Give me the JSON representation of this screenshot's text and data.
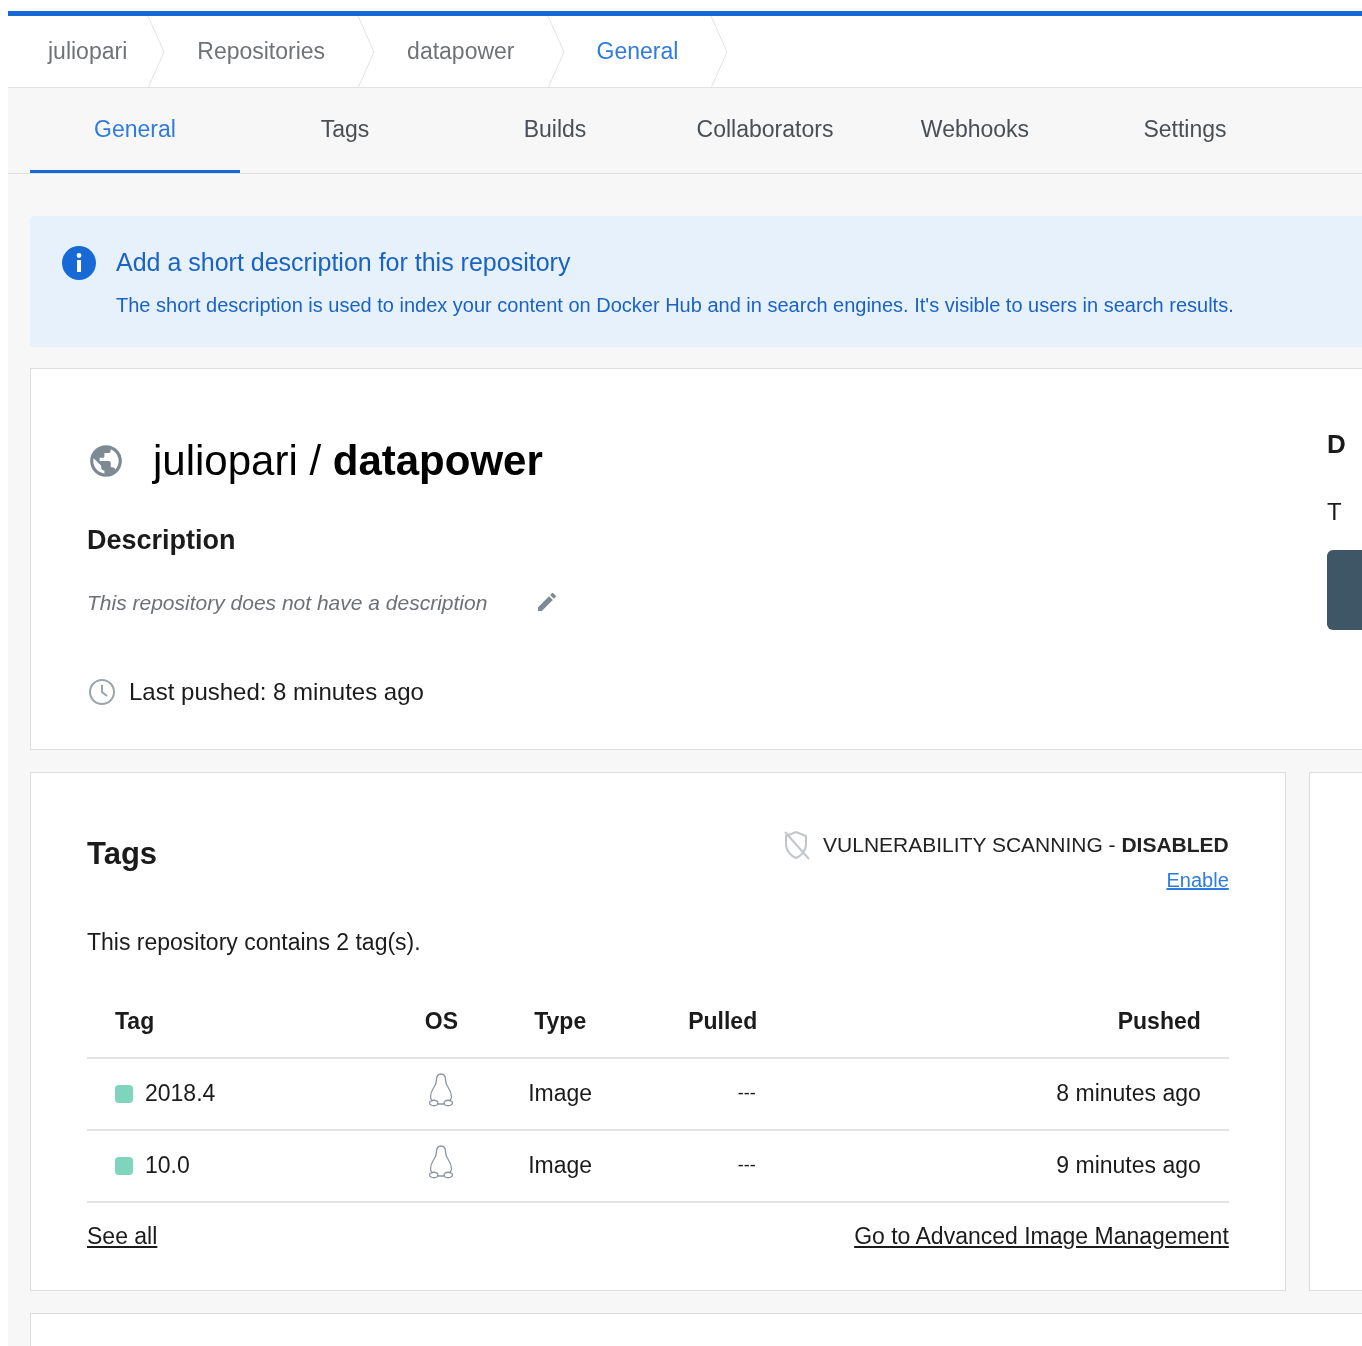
{
  "breadcrumbs": [
    {
      "label": "juliopari",
      "selected": false
    },
    {
      "label": "Repositories",
      "selected": false
    },
    {
      "label": "datapower",
      "selected": false
    },
    {
      "label": "General",
      "selected": true
    }
  ],
  "tabs": [
    {
      "label": "General",
      "selected": true
    },
    {
      "label": "Tags",
      "selected": false
    },
    {
      "label": "Builds",
      "selected": false
    },
    {
      "label": "Collaborators",
      "selected": false
    },
    {
      "label": "Webhooks",
      "selected": false
    },
    {
      "label": "Settings",
      "selected": false
    }
  ],
  "notice": {
    "title": "Add a short description for this repository",
    "text": "The short description is used to index your content on Docker Hub and in search engines. It's visible to users in search results."
  },
  "repository": {
    "owner": "juliopari",
    "separator": "/",
    "name": "datapower",
    "description_heading": "Description",
    "description": "This repository does not have a description",
    "last_pushed": "Last pushed: 8 minutes ago",
    "side_heading": "D",
    "side_text": "T"
  },
  "tags_card": {
    "title": "Tags",
    "scanning_label": "VULNERABILITY SCANNING - ",
    "scanning_state": "DISABLED",
    "enable_link": "Enable",
    "summary": "This repository contains 2 tag(s).",
    "columns": [
      "Tag",
      "OS",
      "Type",
      "Pulled",
      "Pushed"
    ],
    "rows": [
      {
        "tag": "2018.4",
        "color": "#7fd4bd",
        "type": "Image",
        "pulled": "---",
        "pushed": "8 minutes ago"
      },
      {
        "tag": "10.0",
        "color": "#7fd4bd",
        "type": "Image",
        "pulled": "---",
        "pushed": "9 minutes ago"
      }
    ],
    "see_all": "See all",
    "advanced_link": "Go to Advanced Image Management"
  }
}
